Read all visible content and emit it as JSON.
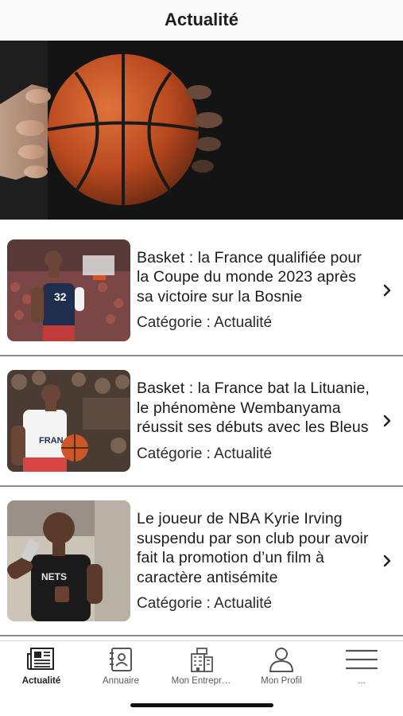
{
  "header": {
    "title": "Actualité"
  },
  "articles": [
    {
      "title": "Basket : la France qualifiée pour la Coupe du monde 2023 après sa victoire sur la Bosnie",
      "category": "Catégorie : Actualité",
      "jersey_number": "32"
    },
    {
      "title": "Basket : la France bat la Lituanie, le phénomène Wembanyama réussit ses débuts avec les Bleus",
      "category": "Catégorie : Actualité",
      "jersey_text": "FRAN"
    },
    {
      "title": "Le joueur de NBA Kyrie Irving suspendu par son club pour avoir fait la promotion d’un film à caractère antisémite",
      "category": "Catégorie : Actualité",
      "jersey_text": "NETS"
    }
  ],
  "tabbar": {
    "items": [
      {
        "label": "Actualité",
        "icon": "newspaper-icon",
        "active": true
      },
      {
        "label": "Annuaire",
        "icon": "contacts-book-icon",
        "active": false
      },
      {
        "label": "Mon Entrepr…",
        "icon": "building-icon",
        "active": false
      },
      {
        "label": "Mon Profil",
        "icon": "user-icon",
        "active": false
      },
      {
        "label": "...",
        "icon": "menu-icon",
        "active": false
      }
    ]
  },
  "colors": {
    "accent": "#1d1d1d",
    "divider": "#8a8a8a",
    "ball": "#c9572a"
  }
}
